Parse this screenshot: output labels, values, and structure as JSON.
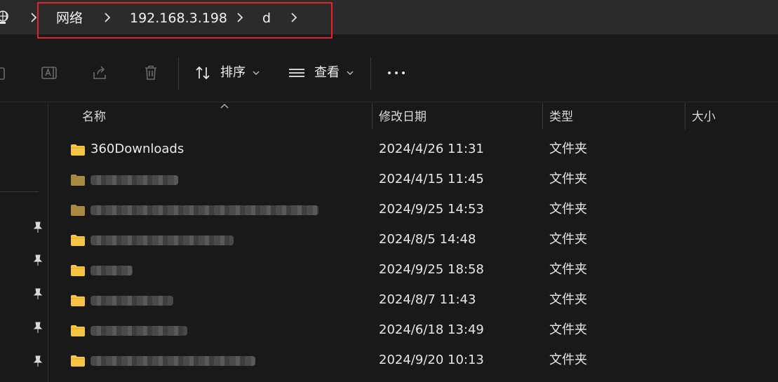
{
  "address": {
    "breadcrumbs": [
      "网络",
      "192.168.3.198",
      "d"
    ]
  },
  "toolbar": {
    "sort_label": "排序",
    "view_label": "查看",
    "more_label": "..."
  },
  "columns": {
    "name": "名称",
    "modified": "修改日期",
    "type": "类型",
    "size": "大小"
  },
  "files": [
    {
      "name": "360Downloads",
      "date": "2024/4/26 11:31",
      "type": "文件夹",
      "dim": false
    },
    {
      "name": "",
      "date": "2024/4/15 11:45",
      "type": "文件夹",
      "dim": true
    },
    {
      "name": "",
      "date": "2024/9/25 14:53",
      "type": "文件夹",
      "dim": true
    },
    {
      "name": "",
      "date": "2024/8/5 14:48",
      "type": "文件夹",
      "dim": false
    },
    {
      "name": "",
      "date": "2024/9/25 18:58",
      "type": "文件夹",
      "dim": false
    },
    {
      "name": "",
      "date": "2024/8/7 11:43",
      "type": "文件夹",
      "dim": false
    },
    {
      "name": "",
      "date": "2024/6/18 13:49",
      "type": "文件夹",
      "dim": false
    },
    {
      "name": "",
      "date": "2024/9/20 10:13",
      "type": "文件夹",
      "dim": false
    }
  ],
  "colors": {
    "folder": "#f7c544",
    "folder_dim": "#a7893f",
    "highlight": "#e0262d"
  }
}
